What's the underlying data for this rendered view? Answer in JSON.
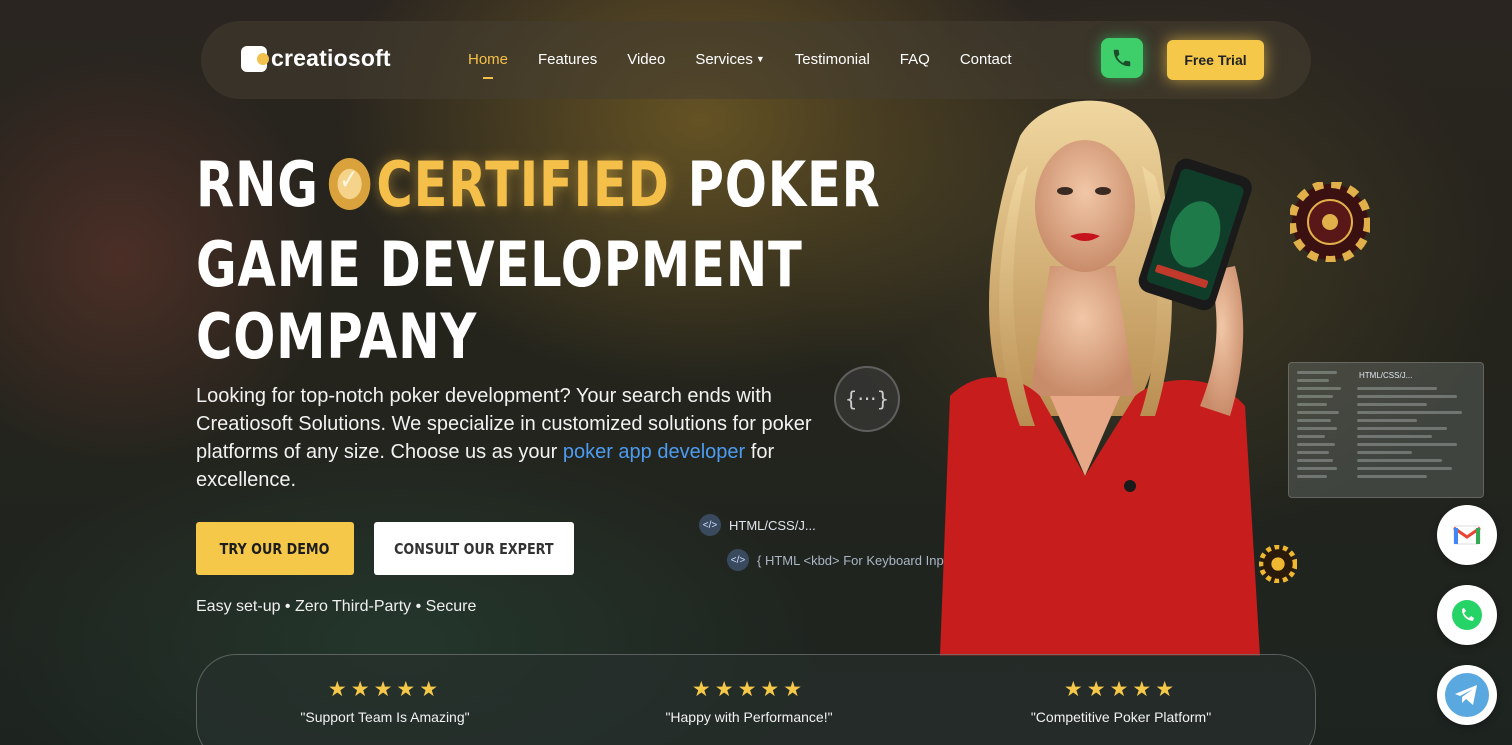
{
  "brand": {
    "name": "creatiosoft"
  },
  "nav": {
    "items": [
      {
        "label": "Home",
        "active": true
      },
      {
        "label": "Features",
        "active": false
      },
      {
        "label": "Video",
        "active": false
      },
      {
        "label": "Services",
        "active": false,
        "has_dropdown": true
      },
      {
        "label": "Testimonial",
        "active": false
      },
      {
        "label": "FAQ",
        "active": false
      },
      {
        "label": "Contact",
        "active": false
      }
    ],
    "phone_icon": "phone-icon",
    "cta_label": "Free Trial"
  },
  "hero": {
    "line1_pre": "RNG",
    "line1_highlight": "CERTIFIED",
    "line1_post": "POKER",
    "line2": "GAME DEVELOPMENT",
    "line3": "COMPANY",
    "badge_icon": "certified-badge-icon",
    "lead_text": "Looking for top-notch poker development? Your search ends with Creatiosoft Solutions. We specialize in customized solutions for poker platforms of any size. Choose us as your ",
    "lead_link": "poker app developer",
    "lead_after": " for excellence.",
    "primary_button": "TRY OUR DEMO",
    "secondary_button": "CONSULT OUR EXPERT",
    "features": "Easy set-up • Zero Third-Party • Secure"
  },
  "code_decor": {
    "circle_glyph": "{···}",
    "tag1_icon": "</>",
    "tag1": "HTML/CSS/J...",
    "tag2_icon": "</>",
    "tag2": "{ HTML <kbd> For Keyboard Input }",
    "panel_title": "HTML/CSS/J..."
  },
  "side_buttons": [
    {
      "name": "gmail",
      "icon": "gmail-icon"
    },
    {
      "name": "whatsapp",
      "icon": "whatsapp-icon"
    },
    {
      "name": "telegram",
      "icon": "telegram-icon"
    }
  ],
  "reviews": [
    {
      "stars": "★★★★★",
      "rating": 5,
      "quote": "\"Support Team Is Amazing\""
    },
    {
      "stars": "★★★★★",
      "rating": 5,
      "quote": "\"Happy with Performance!\""
    },
    {
      "stars": "★★★★★",
      "rating": 5,
      "quote": "\"Competitive Poker Platform\""
    }
  ],
  "colors": {
    "accent": "#f5c04a",
    "link": "#4d9cf0",
    "phone": "#3ecf6a"
  }
}
